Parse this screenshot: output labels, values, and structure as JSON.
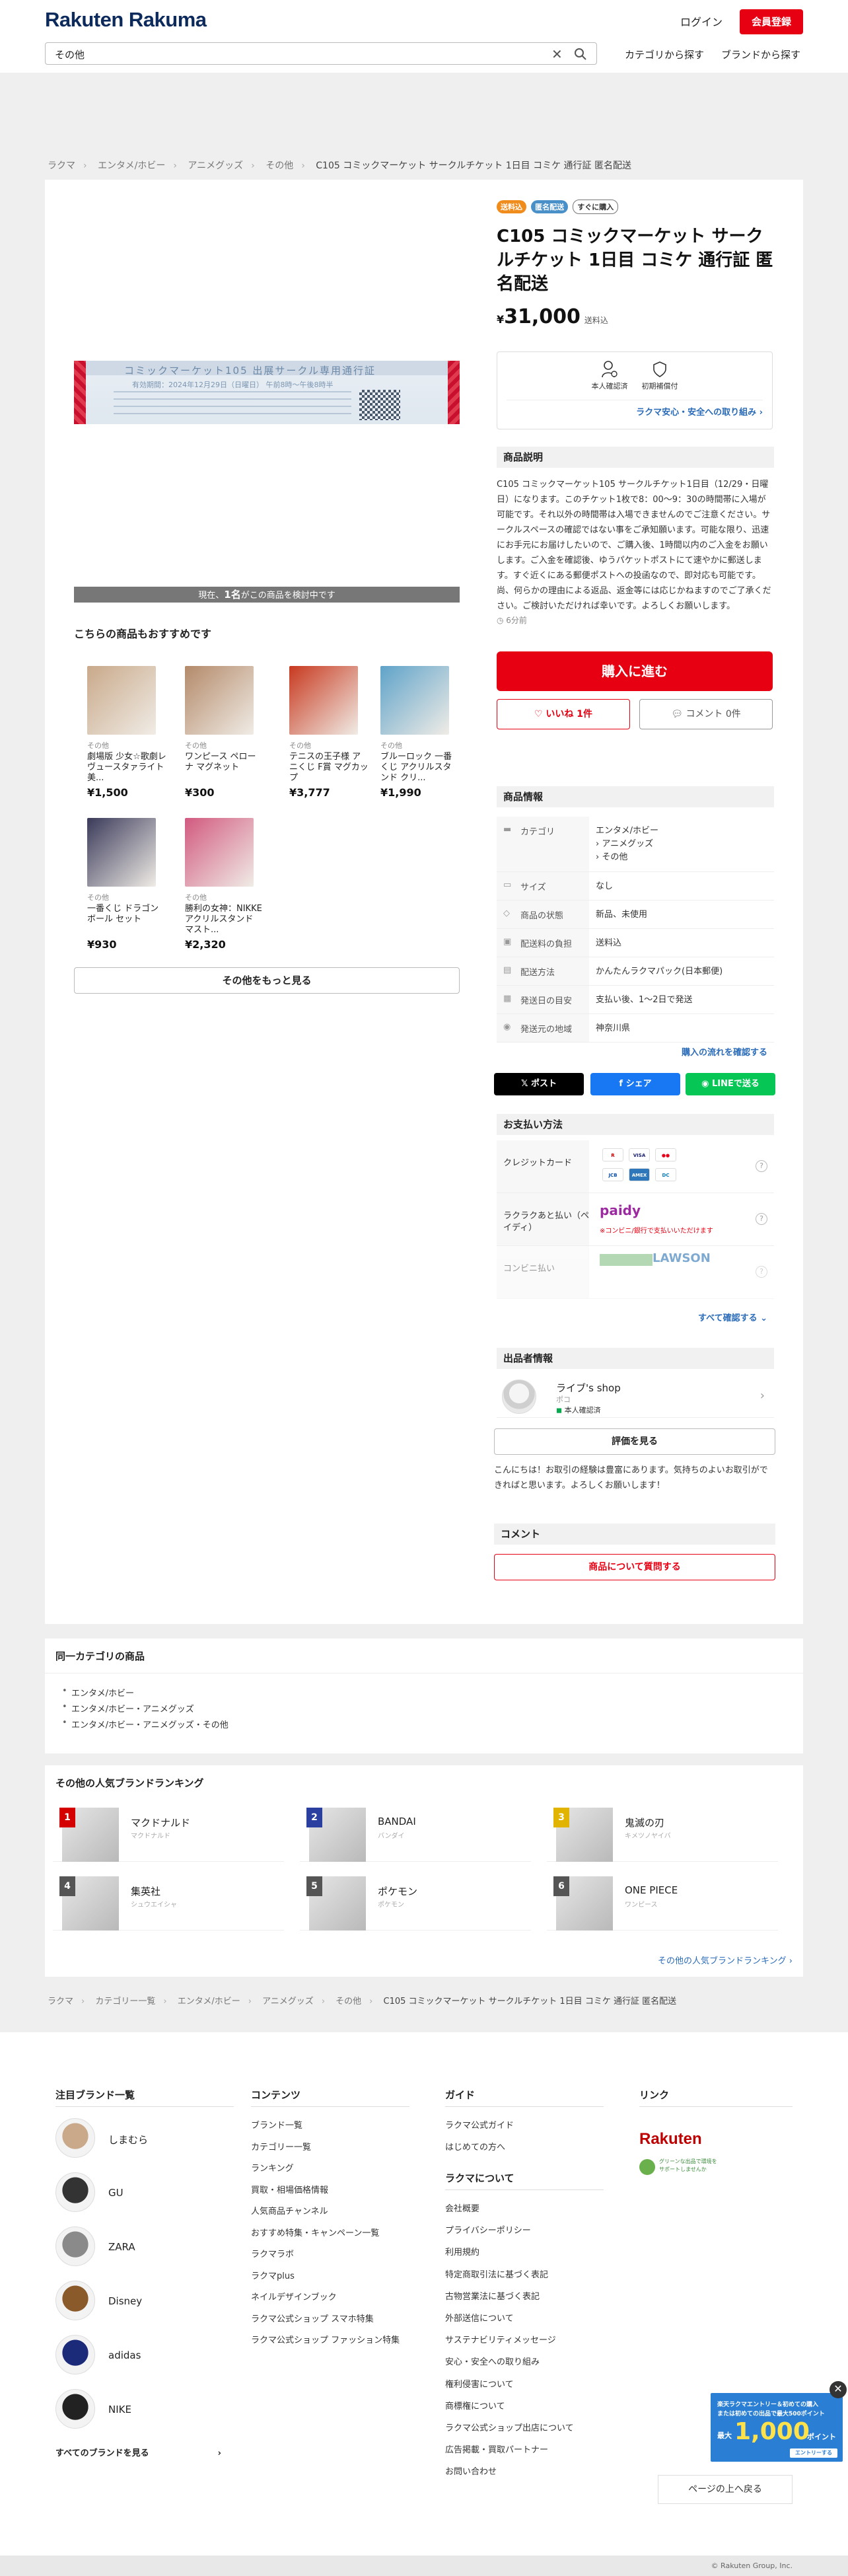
{
  "header": {
    "logo": "Rakuten Rakuma",
    "login": "ログイン",
    "signup": "会員登録",
    "search_value": "その他",
    "nav_category": "カテゴリから探す",
    "nav_brand": "ブランドから探す"
  },
  "breadcrumb": [
    "ラクマ",
    "エンタメ/ホビー",
    "アニメグッズ",
    "その他",
    "C105 コミックマーケット サークルチケット 1日目 コミケ 通行証 匿名配送"
  ],
  "image": {
    "title": "コミックマーケット105 出展サークル専用通行証",
    "sub": "有効期間：2024年12月29日（日曜日） 午前8時〜午後8時半",
    "viewing_prefix": "現在、",
    "viewing_count": "1名",
    "viewing_suffix": "がこの商品を検討中です"
  },
  "recommended": {
    "title": "こちらの商品もおすすめです",
    "items": [
      {
        "category": "その他",
        "name": "劇場版 少女☆歌劇レヴュースタァライト 美...",
        "price": "¥1,500",
        "color": "#c9a98a"
      },
      {
        "category": "その他",
        "name": "ワンピース ペローナ マグネット",
        "price": "¥300",
        "color": "#b48a6a"
      },
      {
        "category": "その他",
        "name": "テニスの王子様 アニくじ F賞 マグカップ",
        "price": "¥3,777",
        "color": "#c8391f"
      },
      {
        "category": "その他",
        "name": "ブルーロック 一番くじ アクリルスタンド クリ...",
        "price": "¥1,990",
        "color": "#5fa3c9"
      },
      {
        "category": "その他",
        "name": "一番くじ ドラゴンボール セット",
        "price": "¥930",
        "color": "#3a3a5a"
      },
      {
        "category": "その他",
        "name": "勝利の女神：NIKKE アクリルスタンド マスト...",
        "price": "¥2,320",
        "color": "#d25a80"
      }
    ],
    "more": "その他をもっと見る"
  },
  "product": {
    "tags": [
      "送料込",
      "匿名配送",
      "すぐに購入"
    ],
    "title": "C105 コミックマーケット サークルチケット 1日目 コミケ 通行証 匿名配送",
    "yen": "¥",
    "price": "31,000",
    "ship_note": "送料込",
    "trust_verified": "本人確認済",
    "trust_guarantee": "初期補償付",
    "trust_link": "ラクマ安心・安全への取り組み ›",
    "desc_head": "商品説明",
    "description": "C105 コミックマーケット105 サークルチケット1日目（12/29・日曜日）になります。このチケット1枚で8：00〜9：30の時間帯に入場が可能です。それ以外の時間帯は入場できませんのでご注意ください。サークルスペースの確認ではない事をご承知願います。可能な限り、迅速にお手元にお届けしたいので、ご購入後、1時間以内のご入金をお願いします。ご入金を確認後、ゆうパケットポストにて速やかに郵送します。すぐ近くにある郵便ポストへの投函なので、即対応も可能です。尚、何らかの理由による返品、返金等には応じかねますのでご了承ください。ご検討いただければ幸いです。よろしくお願いします。",
    "time": "6分前",
    "buy": "購入に進む",
    "like": "いいね 1件",
    "comment": "コメント 0件"
  },
  "info": {
    "head": "商品情報",
    "rows": [
      {
        "key": "カテゴリ",
        "val": "エンタメ/ホビー\n› アニメグッズ\n› その他"
      },
      {
        "key": "サイズ",
        "val": "なし"
      },
      {
        "key": "商品の状態",
        "val": "新品、未使用"
      },
      {
        "key": "配送料の負担",
        "val": "送料込"
      },
      {
        "key": "配送方法",
        "val": "かんたんラクマパック(日本郵便)"
      },
      {
        "key": "発送日の目安",
        "val": "支払い後、1〜2日で発送"
      },
      {
        "key": "発送元の地域",
        "val": "神奈川県"
      }
    ],
    "route_link": "購入の流れを確認する"
  },
  "share": {
    "x": "ポスト",
    "facebook": "シェア",
    "line": "LINEで送る"
  },
  "payment": {
    "head": "お支払い方法",
    "credit": "クレジットカード",
    "paidy_label": "ラクラクあと払い（ペイディ）",
    "paidy_brand": "paidy",
    "paidy_note": "※コンビニ/銀行で支払いいただけます",
    "conv": "コンビニ払い",
    "lawson": "LAWSON",
    "all": "すべて確認する"
  },
  "seller": {
    "head": "出品者情報",
    "name": "ライブ's shop",
    "sub": "ポコ",
    "verified": "本人確認済",
    "reviews": "評価を見る",
    "message": "こんにちは！お取引の経験は豊富にあります。気持ちのよいお取引ができればと思います。よろしくお願いします！"
  },
  "comments": {
    "head": "コメント",
    "ask": "商品について質問する"
  },
  "same_category": {
    "title": "同一カテゴリの商品",
    "items": [
      "エンタメ/ホビー",
      "エンタメ/ホビー・アニメグッズ",
      "エンタメ/ホビー・アニメグッズ・その他"
    ]
  },
  "ranking": {
    "title": "その他の人気ブランドランキング",
    "items": [
      {
        "rank": "1",
        "name": "マクドナルド",
        "kana": "マクドナルド",
        "color": "#d40000"
      },
      {
        "rank": "2",
        "name": "BANDAI",
        "kana": "バンダイ",
        "color": "#2a3fa0"
      },
      {
        "rank": "3",
        "name": "鬼滅の刃",
        "kana": "キメツノヤイバ",
        "color": "#e0b400"
      },
      {
        "rank": "4",
        "name": "集英社",
        "kana": "シュウエイシャ",
        "color": "#555555"
      },
      {
        "rank": "5",
        "name": "ポケモン",
        "kana": "ポケモン",
        "color": "#555555"
      },
      {
        "rank": "6",
        "name": "ONE PIECE",
        "kana": "ワンピース",
        "color": "#555555"
      }
    ],
    "more": "その他の人気ブランドランキング ›"
  },
  "breadcrumb2": [
    "ラクマ",
    "カテゴリー一覧",
    "エンタメ/ホビー",
    "アニメグッズ",
    "その他",
    "C105 コミックマーケット サークルチケット 1日目 コミケ 通行証 匿名配送"
  ],
  "footer": {
    "brands_head": "注目ブランド一覧",
    "brands": [
      "しまむら",
      "GU",
      "ZARA",
      "Disney",
      "adidas",
      "NIKE"
    ],
    "all_brands": "すべてのブランドを見る",
    "contents_head": "コンテンツ",
    "contents": [
      "ブランド一覧",
      "カテゴリー一覧",
      "ランキング",
      "買取・相場価格情報",
      "人気商品チャンネル",
      "おすすめ特集・キャンペーン一覧",
      "ラクマラボ",
      "ラクマplus",
      "ネイルデザインブック",
      "ラクマ公式ショップ スマホ特集",
      "ラクマ公式ショップ ファッション特集"
    ],
    "guide_head": "ガイド",
    "guide": [
      "ラクマ公式ガイド",
      "はじめての方へ"
    ],
    "about_head": "ラクマについて",
    "about": [
      "会社概要",
      "プライバシーポリシー",
      "利用規約",
      "特定商取引法に基づく表記",
      "古物営業法に基づく表記",
      "外部送信について",
      "サステナビリティメッセージ",
      "安心・安全への取り組み",
      "権利侵害について",
      "商標権について",
      "ラクマ公式ショップ出店について",
      "広告掲載・買取パートナー",
      "お問い合わせ"
    ],
    "links_head": "リンク",
    "rakuten": "Rakuten",
    "eco": "グリーンな出品で環境をサポートしませんか",
    "totop": "ページの上へ戻る",
    "promo_line1": "楽天ラクマエントリー＆初めての購入",
    "promo_line2": "または初めての出品で最大500ポイント",
    "promo_big": "1,000",
    "promo_pt": "ポイント",
    "promo_max": "最大",
    "promo_entry": "エントリーする",
    "copyright": "© Rakuten Group, Inc."
  }
}
